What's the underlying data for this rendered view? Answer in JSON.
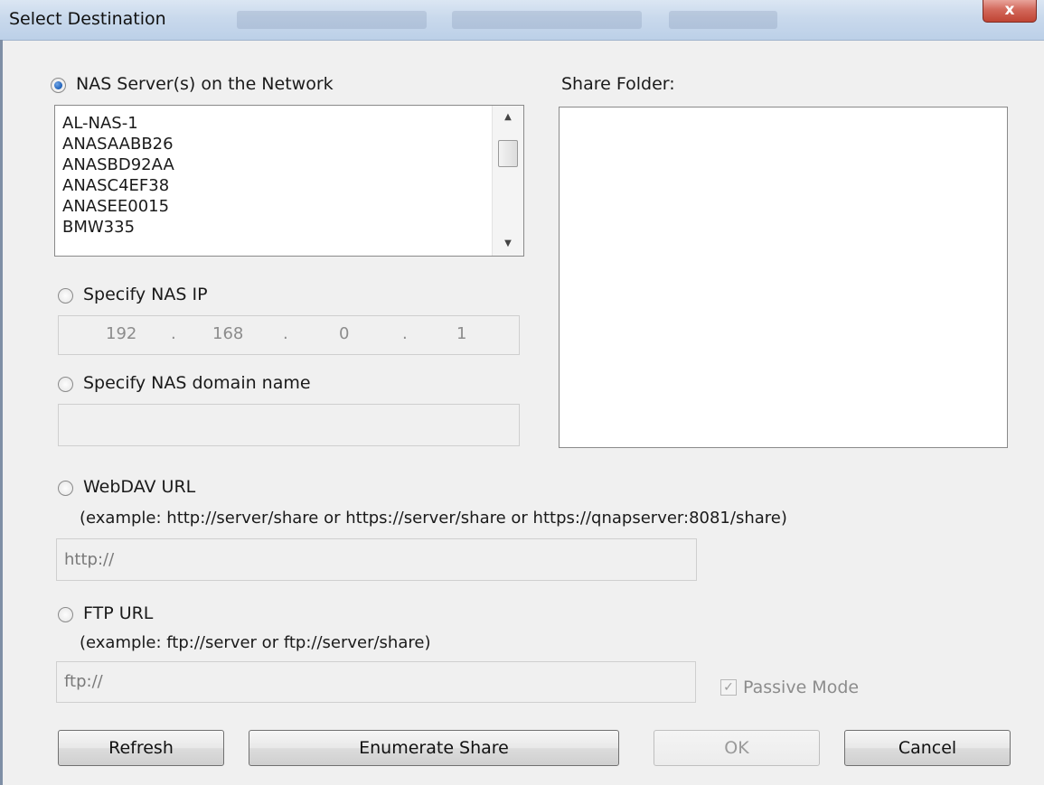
{
  "window": {
    "title": "Select Destination",
    "close_label": "x"
  },
  "nas_servers": {
    "radio_label": "NAS Server(s) on the Network",
    "selected": true,
    "items": [
      "AL-NAS-1",
      "ANASAABB26",
      "ANASBD92AA",
      "ANASC4EF38",
      "ANASEE0015",
      "BMW335"
    ]
  },
  "share_folder": {
    "label": "Share Folder:"
  },
  "nas_ip": {
    "radio_label": "Specify NAS IP",
    "octets": [
      "192",
      "168",
      "0",
      "1"
    ],
    "dot": "."
  },
  "nas_domain": {
    "radio_label": "Specify NAS domain name",
    "value": ""
  },
  "webdav": {
    "radio_label": "WebDAV URL",
    "example": "(example: http://server/share or https://server/share or https://qnapserver:8081/share)",
    "value": "http://"
  },
  "ftp": {
    "radio_label": "FTP URL",
    "example": "(example: ftp://server or ftp://server/share)",
    "value": "ftp://",
    "passive_label": "Passive Mode",
    "passive_checked": true
  },
  "buttons": {
    "refresh": "Refresh",
    "enumerate": "Enumerate Share",
    "ok": "OK",
    "cancel": "Cancel"
  }
}
